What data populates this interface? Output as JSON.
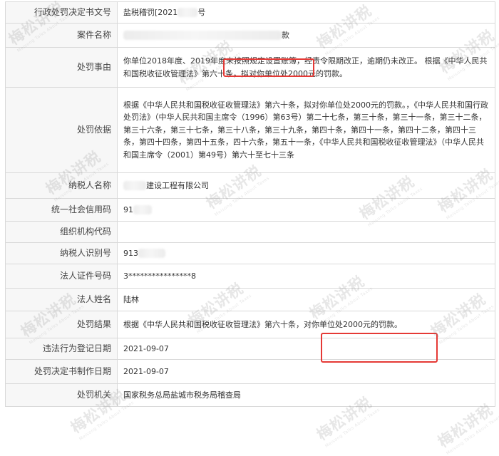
{
  "record": {
    "rows": [
      {
        "label": "行政处罚决定书文号",
        "value": "盐税稽罚[2021",
        "value_tail": "号"
      },
      {
        "label": "案件名称",
        "value": "",
        "value_tail": "款"
      },
      {
        "label": "处罚事由",
        "value_pre": "你单位2018年度、2019年度",
        "value_box": "未按照规定设置账簿",
        "value_post": "，经责令限期改正，逾期仍未改正。 根据《中华人民共和国税收征收管理法》第六十条，拟对你单位处2000元的罚款。"
      },
      {
        "label": "处罚依据",
        "value": "根据《中华人民共和国税收征收管理法》第六十条，拟对你单位处2000元的罚款。，《中华人民共和国行政处罚法》（中华人民共和国主席令（1996）第63号）第二十七条，第三十条，第三十一条，第三十二条，第三十六条，第三十七条，第三十八条，第三十九条，第四十条，第四十一条，第四十二条，第四十三条，第四十四条，第四十五条，四十六条，第五十一条，《中华人民共和国税收征收管理法》（中华人民共和国主席令（2001）第49号）第六十至七十三条"
      },
      {
        "label": "纳税人名称",
        "value": "",
        "value_tail": "建设工程有限公司"
      },
      {
        "label": "统一社会信用码",
        "value": "91"
      },
      {
        "label": "组织机构代码",
        "value": ""
      },
      {
        "label": "纳税人识别号",
        "value": "913"
      },
      {
        "label": "法人证件号码",
        "value": "3****************8"
      },
      {
        "label": "法人姓名",
        "value": "陆林"
      },
      {
        "label": "处罚结果",
        "value_pre": "根据《中华人民共和国税收征收管理法》第六十条，",
        "value_box": "对你单位处2000元的罚款。",
        "value_post": ""
      },
      {
        "label": "违法行为登记日期",
        "value": "2021-09-07"
      },
      {
        "label": "处罚决定书制作日期",
        "value": "2021-09-07"
      },
      {
        "label": "处罚机关",
        "value": "国家税务总局盐城市税务局稽查局"
      }
    ]
  },
  "watermark": {
    "text": "梅松讲税",
    "sub": "Meisong Talks About Taxes"
  },
  "colors": {
    "highlight": "#e53935",
    "label_bg": "#f7f7f7",
    "border": "#d9d9d9"
  }
}
